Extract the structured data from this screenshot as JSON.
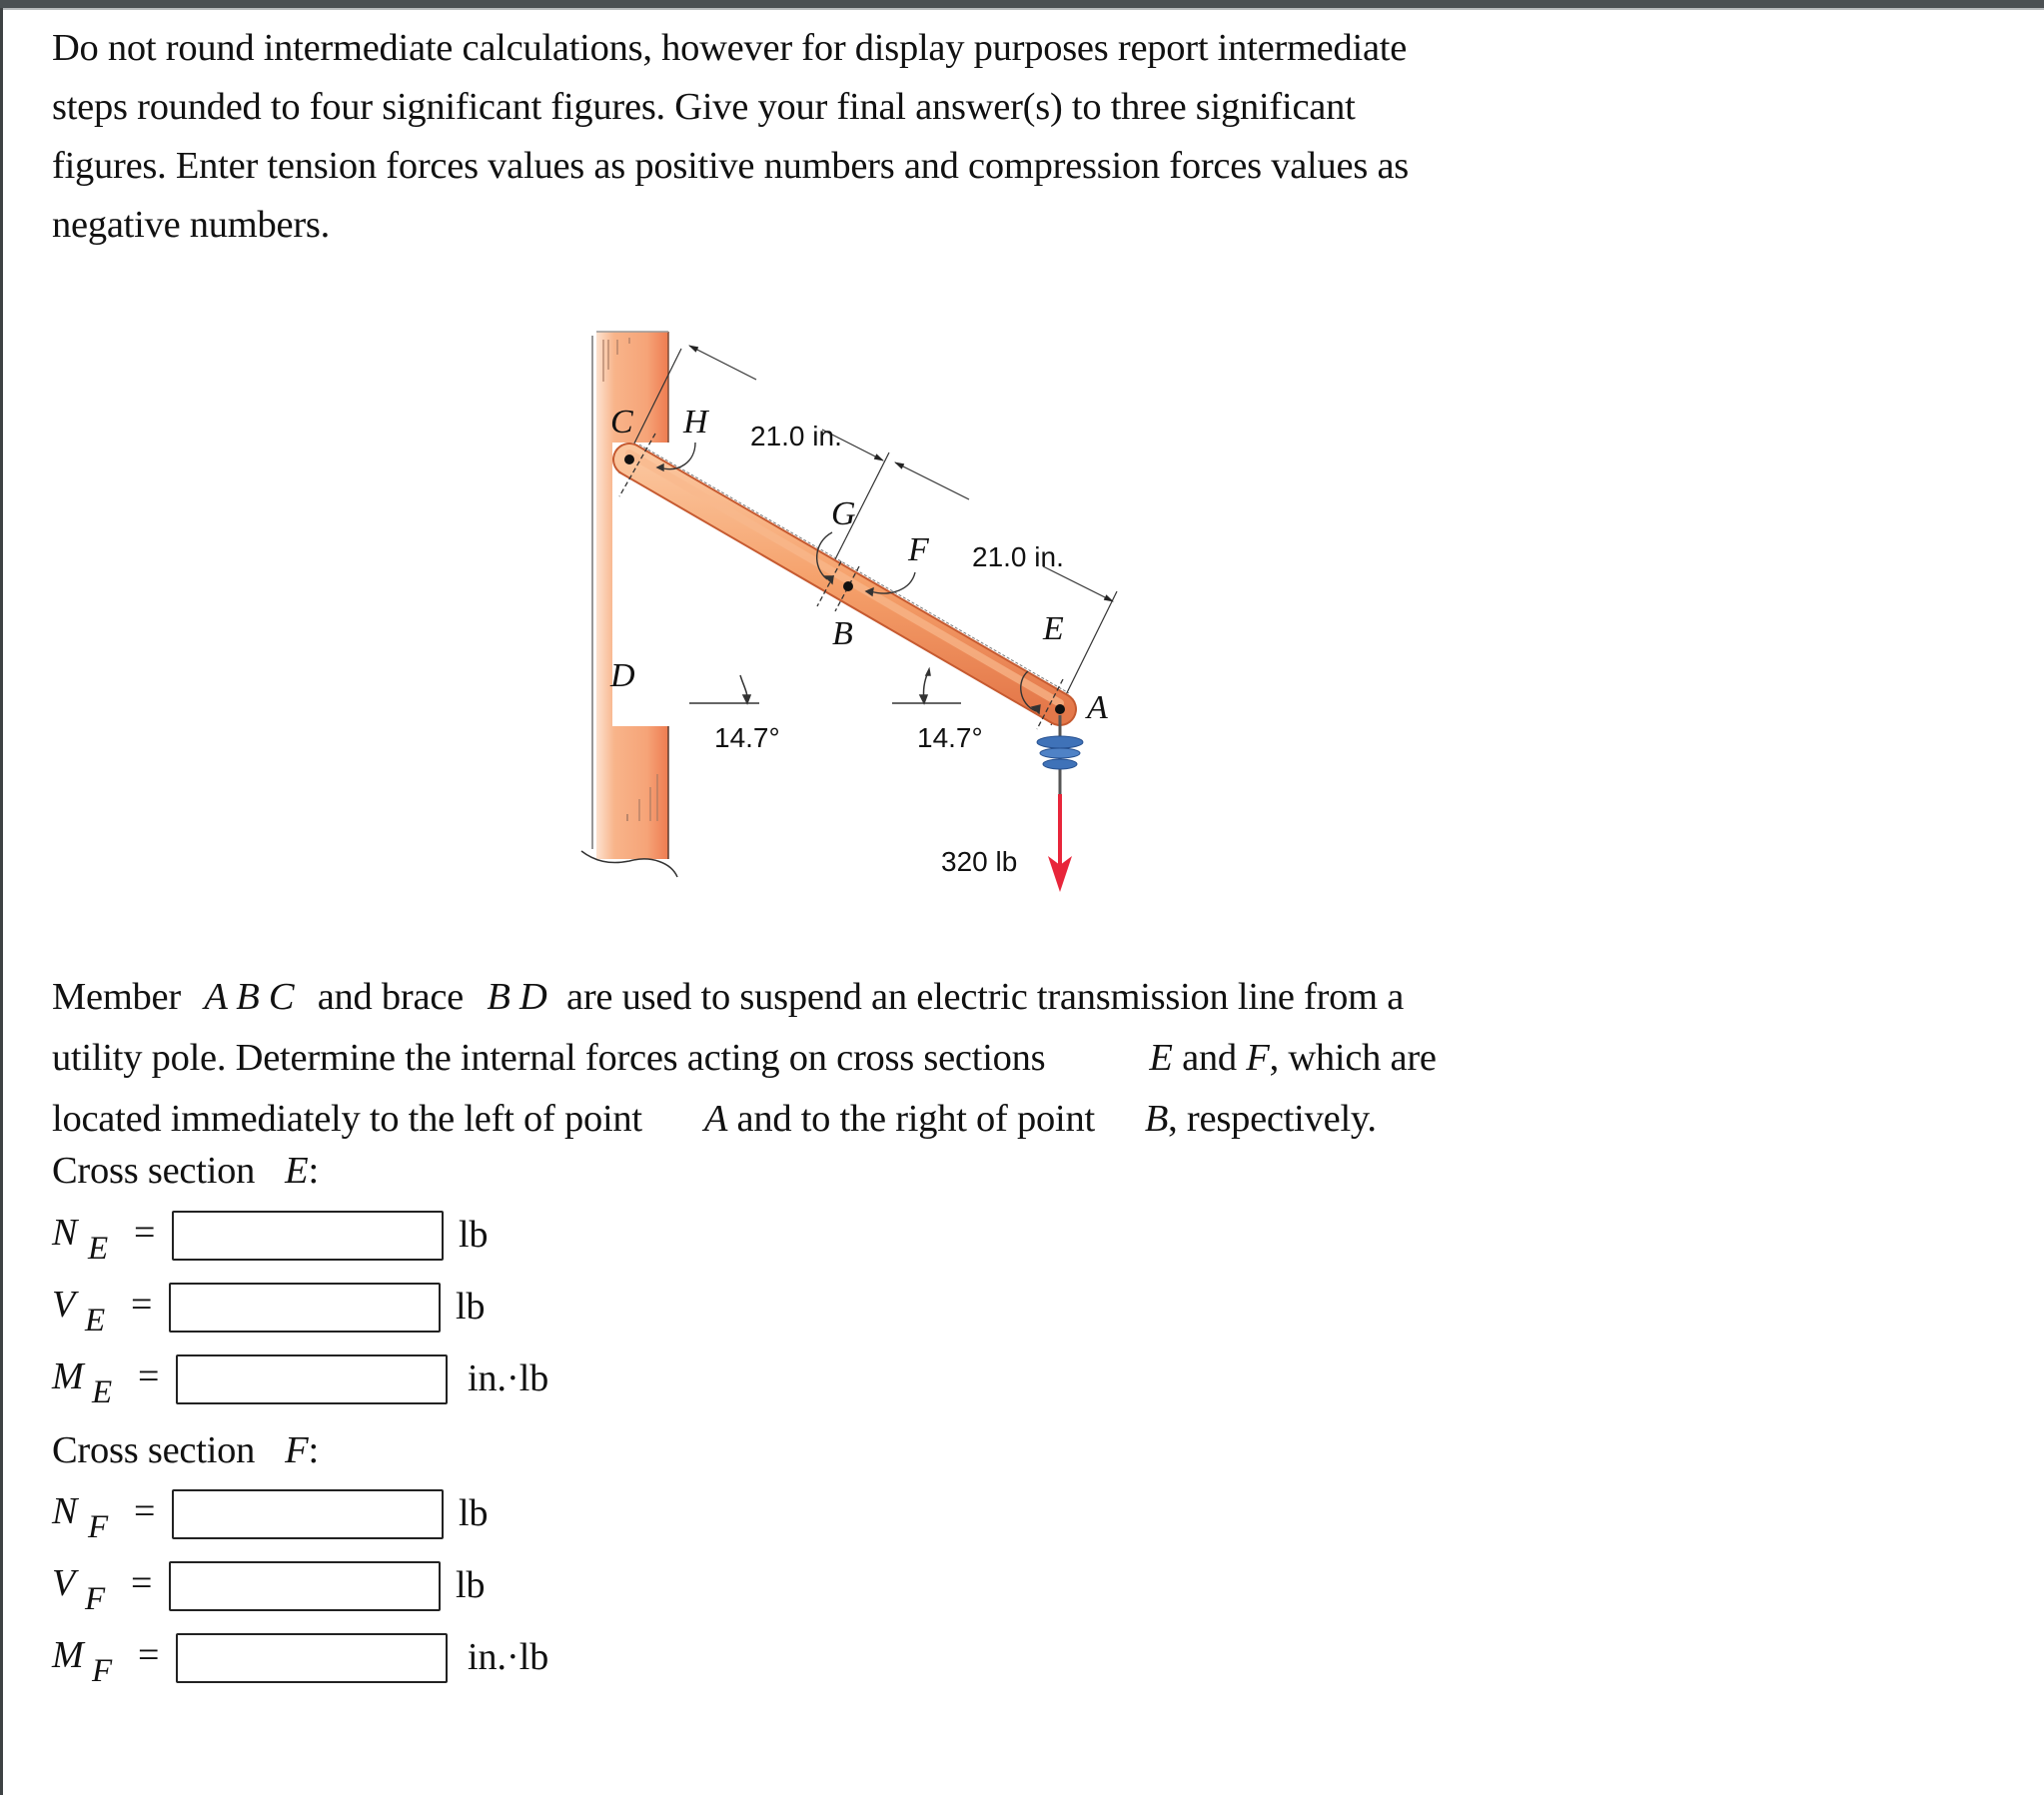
{
  "instructions": {
    "lines": [
      "Do not round intermediate calculations, however for display purposes report intermediate",
      "steps rounded to four significant figures. Give your final answer(s) to three significant",
      "figures. Enter tension forces values as positive numbers and compression forces values as",
      "negative numbers."
    ]
  },
  "figure": {
    "point_labels": {
      "A": "A",
      "B": "B",
      "C": "C",
      "D": "D",
      "E": "E",
      "F": "F",
      "G": "G",
      "H": "H"
    },
    "dimension_top": "21.0 in.",
    "dimension_bottom": "21.0 in.",
    "angle_left": "14.7°",
    "angle_right": "14.7°",
    "load": "320 lb",
    "colors": {
      "member": "#f5a06a",
      "member_dark": "#e4784a",
      "pole": "#f6a478",
      "load_arrow": "#e8253a",
      "insulator": "#3f72b8"
    }
  },
  "problem": {
    "line1": {
      "pre": "Member",
      "v1": "A B C",
      "mid": "and brace",
      "v2": "B D",
      "post": "are used to suspend an electric transmission line from a"
    },
    "line2": {
      "pre": "utility pole. Determine the internal forces acting on cross sections",
      "v1": "E",
      "mid": "and",
      "v2": "F",
      "post": ", which are"
    },
    "line3": {
      "pre": "located immediately to the left of point",
      "v1": "A",
      "mid": "and to the right of point",
      "v2": "B",
      "post": ", respectively."
    }
  },
  "sections": [
    {
      "label": "Cross section",
      "var": "E",
      "colon": ":",
      "fields": [
        {
          "symbol": "N",
          "sub": "E",
          "eq": "=",
          "value": "",
          "placeholder": "",
          "unit": "lb"
        },
        {
          "symbol": "V",
          "sub": "E",
          "eq": "=",
          "value": "",
          "placeholder": "",
          "unit": "lb"
        },
        {
          "symbol": "M",
          "sub": "E",
          "eq": "=",
          "value": "",
          "placeholder": "",
          "unit": "in.·lb"
        }
      ]
    },
    {
      "label": "Cross section",
      "var": "F",
      "colon": ":",
      "fields": [
        {
          "symbol": "N",
          "sub": "F",
          "eq": "=",
          "value": "",
          "placeholder": "",
          "unit": "lb"
        },
        {
          "symbol": "V",
          "sub": "F",
          "eq": "=",
          "value": "",
          "placeholder": "",
          "unit": "lb"
        },
        {
          "symbol": "M",
          "sub": "F",
          "eq": "=",
          "value": "",
          "placeholder": "",
          "unit": "in.·lb"
        }
      ]
    }
  ]
}
